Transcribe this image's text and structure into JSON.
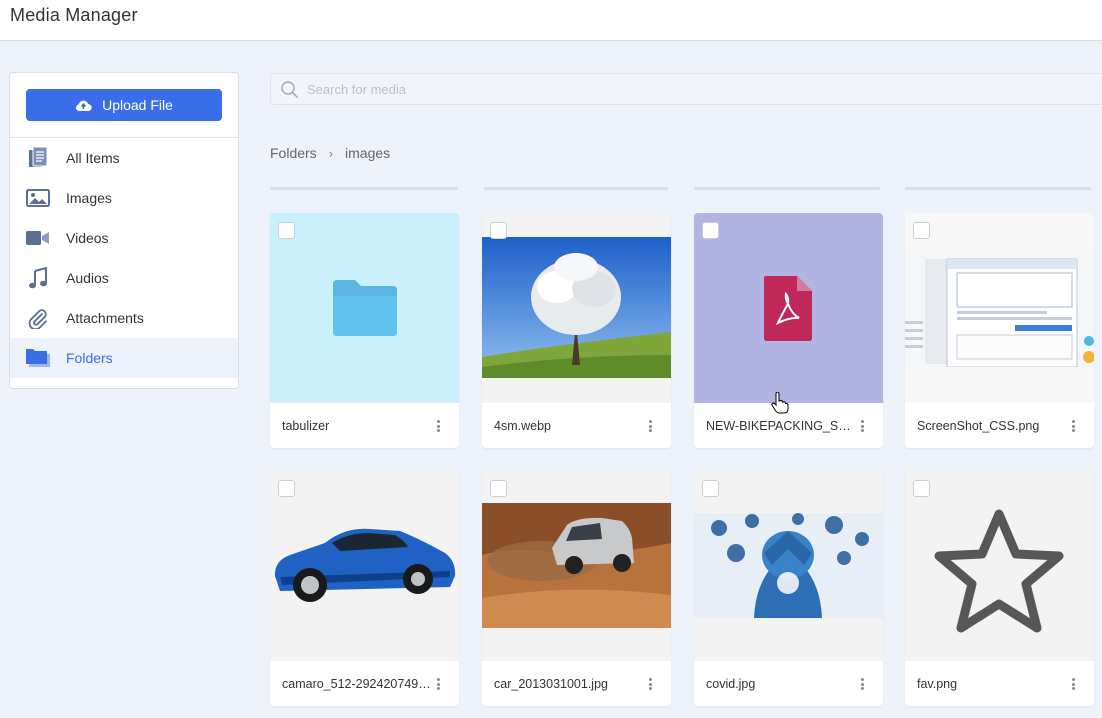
{
  "app": {
    "title": "Media Manager"
  },
  "sidebar": {
    "upload_label": "Upload File",
    "items": [
      {
        "label": "All Items",
        "icon": "files-icon",
        "active": false
      },
      {
        "label": "Images",
        "icon": "image-icon",
        "active": false
      },
      {
        "label": "Videos",
        "icon": "video-icon",
        "active": false
      },
      {
        "label": "Audios",
        "icon": "music-icon",
        "active": false
      },
      {
        "label": "Attachments",
        "icon": "paperclip-icon",
        "active": false
      },
      {
        "label": "Folders",
        "icon": "folder-icon",
        "active": true
      }
    ]
  },
  "search": {
    "placeholder": "Search for media",
    "value": ""
  },
  "breadcrumb": {
    "root": "Folders",
    "separator": "›",
    "current": "images"
  },
  "colors": {
    "accent": "#3a6ee8",
    "folder_bg": "#c9f0fb",
    "pdf_bg": "#b2b4e2",
    "pdf_icon": "#c0285a"
  },
  "items": [
    {
      "name": "tabulizer",
      "kind": "folder"
    },
    {
      "name": "4sm.webp",
      "kind": "image-tree"
    },
    {
      "name": "NEW-BIKEPACKING_STRO...",
      "kind": "pdf"
    },
    {
      "name": "ScreenShot_CSS.png",
      "kind": "image-screenshot"
    },
    {
      "name": "camaro_512-2924207497.p...",
      "kind": "image-car"
    },
    {
      "name": "car_2013031001.jpg",
      "kind": "image-suv"
    },
    {
      "name": "covid.jpg",
      "kind": "image-covid"
    },
    {
      "name": "fav.png",
      "kind": "image-star"
    }
  ]
}
